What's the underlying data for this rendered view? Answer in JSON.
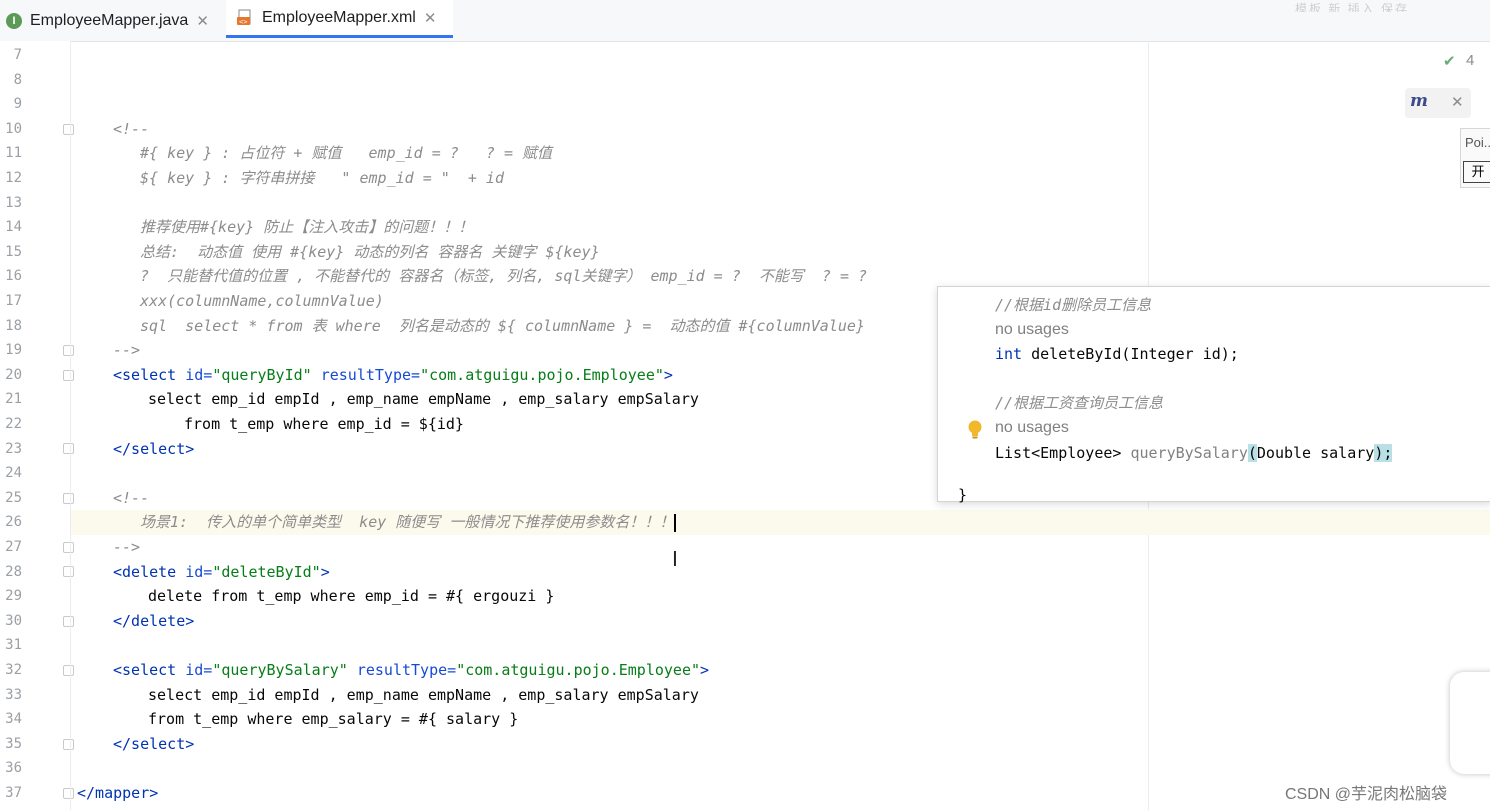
{
  "tabs": [
    {
      "label": "EmployeeMapper.java",
      "icon": "I",
      "active": false
    },
    {
      "label": "EmployeeMapper.xml",
      "active": true
    }
  ],
  "topright_faded": "模板  新  插入  保存",
  "lines": {
    "7": "",
    "8": "",
    "9": "",
    "10": "<!--",
    "11": "#{ key } : 占位符 + 赋值   emp_id = ?   ? = 赋值",
    "12": "${ key } : 字符串拼接   \" emp_id = \"  + id",
    "13": "",
    "14": "推荐使用#{key} 防止【注入攻击】的问题！！！",
    "15": "总结:  动态值 使用 #{key} 动态的列名 容器名 关键字 ${key}",
    "16": "?  只能替代值的位置 , 不能替代的 容器名（标签, 列名, sql关键字） emp_id = ?  不能写  ? = ?",
    "17": "xxx(columnName,columnValue)",
    "18": "sql  select * from 表 where  列名是动态的 ${ columnName } =  动态的值 #{columnValue}",
    "19": "-->",
    "20_tag_open": "<select",
    "20_attr1": "id=",
    "20_val1": "\"queryById\"",
    "20_attr2": "resultType=",
    "20_val2": "\"com.atguigu.pojo.Employee\"",
    "20_close": ">",
    "21": "select emp_id empId , emp_name empName , emp_salary empSalary",
    "22": "from t_emp where emp_id = ${id}",
    "23": "</select>",
    "24": "",
    "25": "<!--",
    "26": "场景1:  传入的单个简单类型  key 随便写 一般情况下推荐使用参数名！！！",
    "27": "-->",
    "28_tag_open": "<delete",
    "28_attr1": "id=",
    "28_val1": "\"deleteById\"",
    "28_close": ">",
    "29": "delete from t_emp where emp_id = #{ ergouzi }",
    "30": "</delete>",
    "31": "",
    "32_tag_open": "<select",
    "32_attr1": "id=",
    "32_val1": "\"queryBySalary\"",
    "32_attr2": "resultType=",
    "32_val2": "\"com.atguigu.pojo.Employee\"",
    "32_close": ">",
    "33": "select emp_id empId , emp_name empName , emp_salary empSalary",
    "34": "from t_emp where emp_salary = #{ salary }",
    "35": "</select>",
    "36": "",
    "37": "</mapper>"
  },
  "popup": {
    "comment1": "//根据id删除员工信息",
    "usages1": "no usages",
    "kw_int": "int",
    "method1": " deleteById(Integer id);",
    "comment2": "//根据工资查询员工信息",
    "usages2": "no usages",
    "type2": "List<Employee> ",
    "method2": "queryBySalary",
    "paren_open": "(",
    "param2": "Double salary",
    "paren_close": ");",
    "brace": "}"
  },
  "inspection_count": "4",
  "side_popup": {
    "title": "Poi...",
    "button": "开"
  },
  "watermark": "CSDN @芋泥肉松脑袋"
}
